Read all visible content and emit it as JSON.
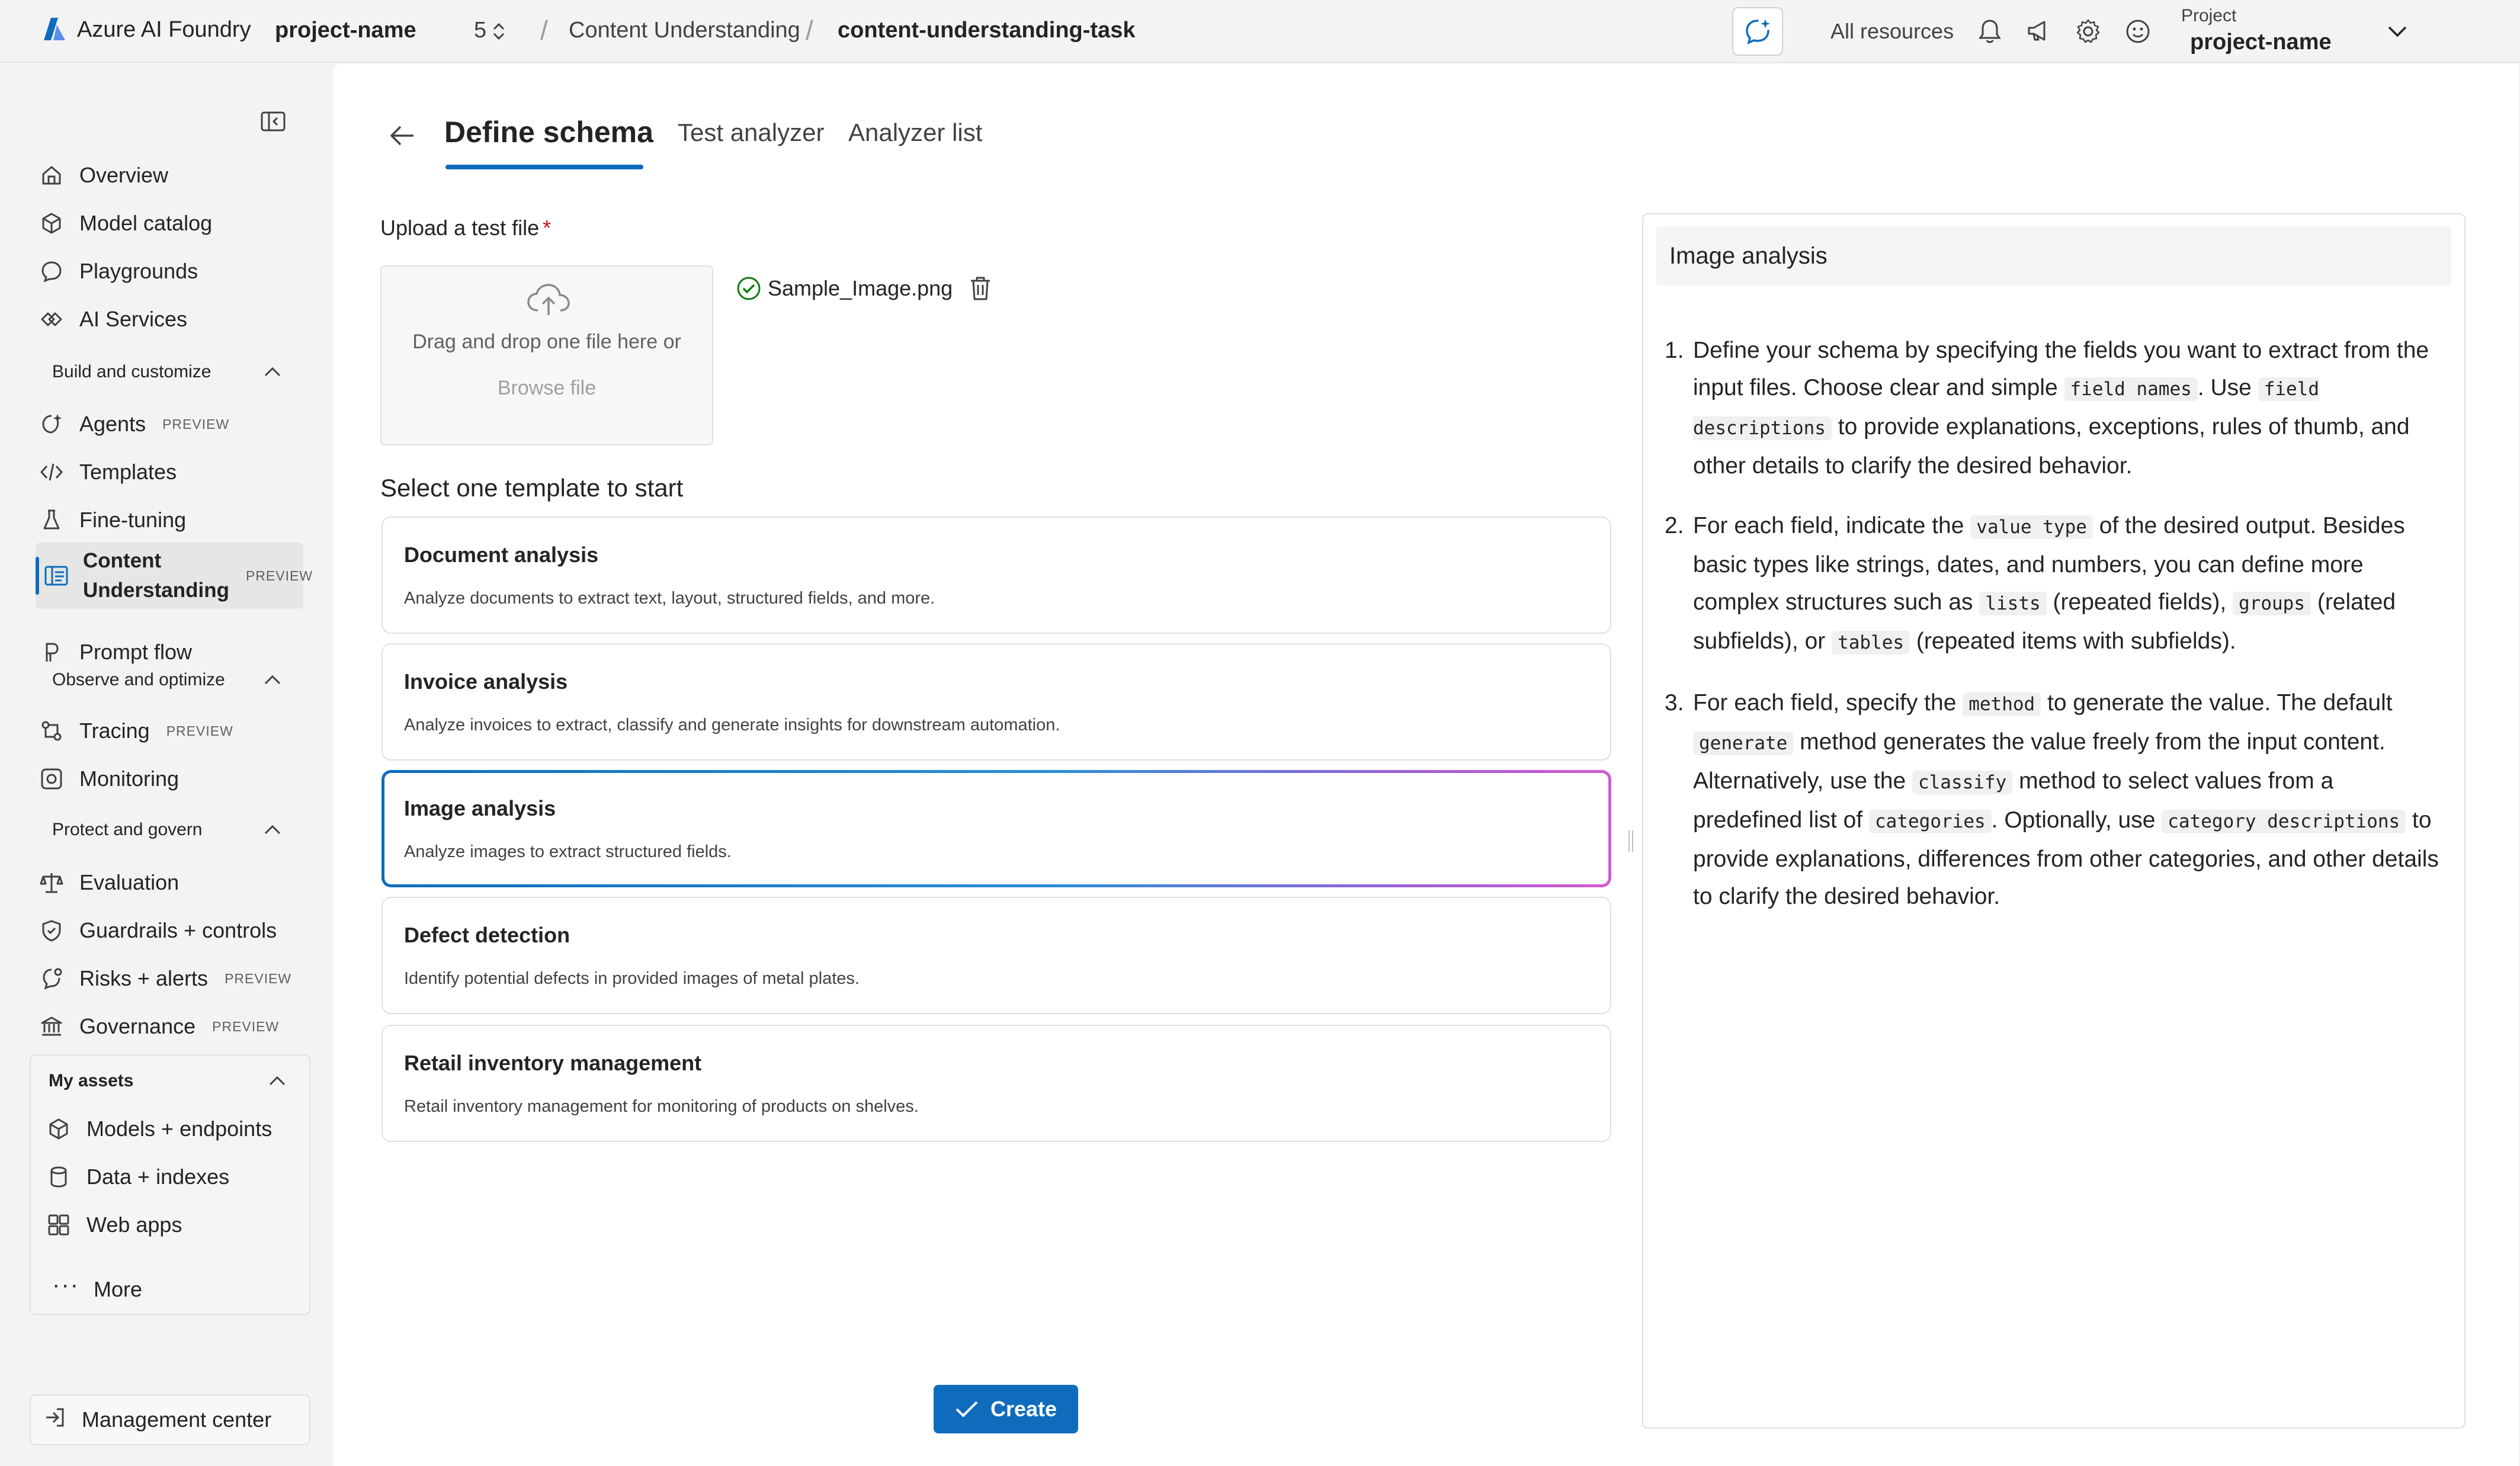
{
  "topbar": {
    "brand": "Azure AI Foundry",
    "project": "project-name",
    "project_suffix": "5",
    "crumb_service": "Content Understanding",
    "crumb_task": "content-understanding-task",
    "all_resources": "All resources",
    "project_label": "Project",
    "project_name": "project-name"
  },
  "sidebar": {
    "items": {
      "overview": "Overview",
      "model_catalog": "Model catalog",
      "playgrounds": "Playgrounds",
      "ai_services": "AI Services",
      "agents": "Agents",
      "templates": "Templates",
      "fine_tuning": "Fine-tuning",
      "content_line1": "Content",
      "content_line2": "Understanding",
      "prompt_flow": "Prompt flow",
      "tracing": "Tracing",
      "monitoring": "Monitoring",
      "evaluation": "Evaluation",
      "guardrails": "Guardrails + controls",
      "risks": "Risks + alerts",
      "governance": "Governance",
      "models_endpoints": "Models + endpoints",
      "data_indexes": "Data + indexes",
      "web_apps": "Web apps",
      "more": "More",
      "management_center": "Management center"
    },
    "badge": "PREVIEW",
    "sections": {
      "build": "Build and customize",
      "observe": "Observe and optimize",
      "protect": "Protect and govern",
      "assets": "My assets"
    }
  },
  "main": {
    "tabs": [
      "Define schema",
      "Test analyzer",
      "Analyzer list"
    ],
    "upload_label": "Upload a test file",
    "required_mark": "*",
    "dropzone_text": "Drag and drop one file here or",
    "browse": "Browse file",
    "file_name": "Sample_Image.png",
    "templates_title": "Select one template to start",
    "templates": [
      {
        "title": "Document analysis",
        "desc": "Analyze documents to extract text, layout, structured fields, and more."
      },
      {
        "title": "Invoice analysis",
        "desc": "Analyze invoices to extract, classify and generate insights for downstream automation."
      },
      {
        "title": "Image analysis",
        "desc": "Analyze images to extract structured fields."
      },
      {
        "title": "Defect detection",
        "desc": "Identify potential defects in provided images of metal plates."
      },
      {
        "title": "Retail inventory management",
        "desc": "Retail inventory management for monitoring of products on shelves."
      }
    ],
    "selected_template": "Image analysis",
    "create": "Create"
  },
  "panel": {
    "title": "Image analysis",
    "steps": [
      {
        "num": "1.",
        "t1": "Define your schema by specifying the fields you want to extract from the input files. Choose clear and simple ",
        "c1": "field names",
        "t2": ". Use ",
        "c2": "field descriptions",
        "t3": " to provide explanations, exceptions, rules of thumb, and other details to clarify the desired behavior."
      },
      {
        "num": "2.",
        "t1": "For each field, indicate the ",
        "c1": "value type",
        "t2": " of the desired output. Besides basic types like strings, dates, and numbers, you can define more complex structures such as ",
        "c2": "lists",
        "t3": " (repeated fields), ",
        "c3": "groups",
        "t4": " (related subfields), or ",
        "c4": "tables",
        "t5": " (repeated items with subfields)."
      },
      {
        "num": "3.",
        "t1": "For each field, specify the ",
        "c1": "method",
        "t2": " to generate the value. The default ",
        "c2": "generate",
        "t3": " method generates the value freely from the input content. Alternatively, use the ",
        "c3": "classify",
        "t4": " method to select values from a predefined list of ",
        "c4": "categories",
        "t5": ". Optionally, use ",
        "c5": "category descriptions",
        "t6": " to provide explanations, differences from other categories, and other details to clarify the desired behavior."
      }
    ]
  },
  "colors": {
    "accent": "#0f6cbd",
    "success": "#107c10",
    "required": "#c50f1f",
    "selected_gradient_end": "#d35bd0"
  }
}
